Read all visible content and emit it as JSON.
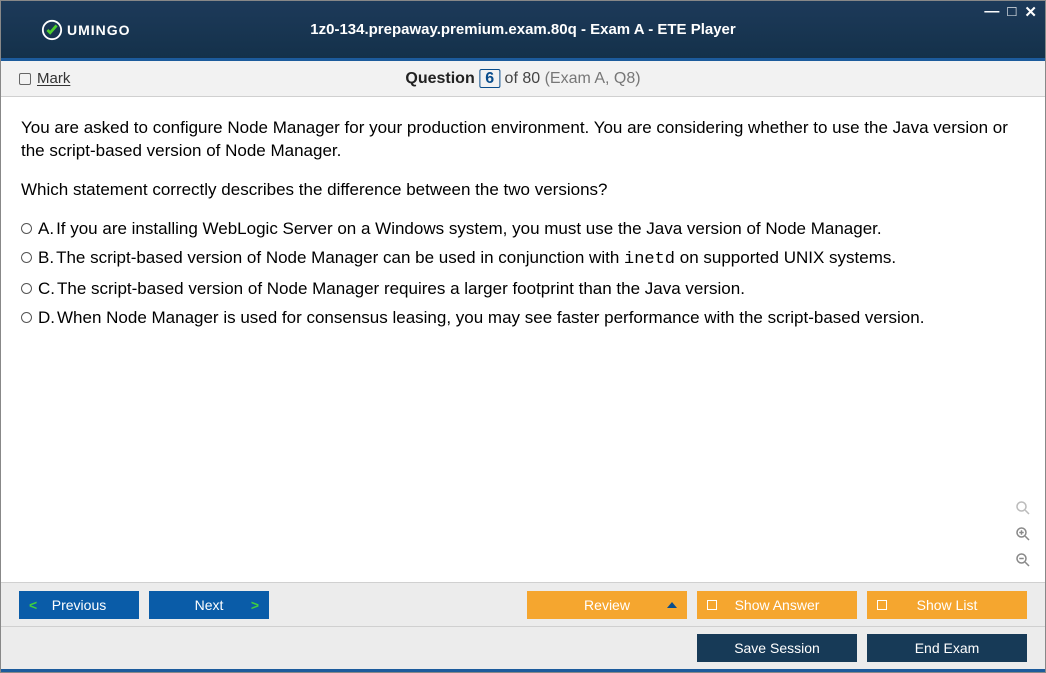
{
  "window": {
    "title": "1z0-134.prepaway.premium.exam.80q - Exam A - ETE Player",
    "brand": "UMINGO"
  },
  "subbar": {
    "mark_label": "Mark",
    "question_word": "Question",
    "question_num": "6",
    "of_text": " of 80 ",
    "paren": "(Exam A, Q8)"
  },
  "question": {
    "p1": "You are asked to configure Node Manager for your production environment. You are considering whether to use the Java version or the script-based version of Node Manager.",
    "p2": "Which statement correctly describes the difference between the two versions?"
  },
  "answers": [
    {
      "letter": "A.",
      "text": "If you are installing WebLogic Server on a Windows system, you must use the Java version of Node Manager."
    },
    {
      "letter": "B.",
      "pre": "The script-based version of Node Manager can be used in conjunction with ",
      "code": "inetd",
      "post": " on supported UNIX systems."
    },
    {
      "letter": "C.",
      "text": "The script-based version of Node Manager requires a larger footprint than the Java version."
    },
    {
      "letter": "D.",
      "text": "When Node Manager is used for consensus leasing, you may see faster performance with the script-based version."
    }
  ],
  "footer": {
    "previous": "Previous",
    "next": "Next",
    "review": "Review",
    "show_answer": "Show Answer",
    "show_list": "Show List",
    "save_session": "Save Session",
    "end_exam": "End Exam"
  }
}
